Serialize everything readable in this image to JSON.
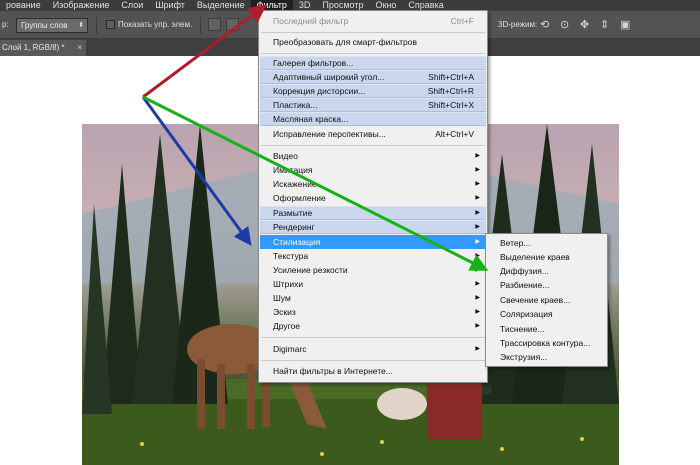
{
  "menubar": {
    "items": [
      "рование",
      "Изображение",
      "Слои",
      "Шрифт",
      "Выделение",
      "Фильтр",
      "3D",
      "Просмотр",
      "Окно",
      "Справка"
    ],
    "active_index": 5
  },
  "options": {
    "prefix": "р:",
    "select_value": "Группы слов",
    "checkbox_label": "Показать упр. элем.",
    "mode_label": "3D-режим:"
  },
  "tab": {
    "label": "Слой 1, RGB/8) *",
    "close": "×"
  },
  "filter_menu": {
    "last_filter": {
      "label": "Последний фильтр",
      "shortcut": "Ctrl+F"
    },
    "convert": "Преобразовать для смарт-фильтров",
    "gallery": "Галерея фильтров...",
    "adaptive": {
      "label": "Адаптивный широкий угол...",
      "shortcut": "Shift+Ctrl+A"
    },
    "lens": {
      "label": "Коррекция дисторсии...",
      "shortcut": "Shift+Ctrl+R"
    },
    "liquify": {
      "label": "Пластика...",
      "shortcut": "Shift+Ctrl+X"
    },
    "oil": "Масляная краска...",
    "vanishing": {
      "label": "Исправление перспективы...",
      "shortcut": "Alt+Ctrl+V"
    },
    "groups": [
      "Видео",
      "Имитация",
      "Искажение",
      "Оформление",
      "Размытие",
      "Рендеринг",
      "Стилизация",
      "Текстура",
      "Усиление резкости",
      "Штрихи",
      "Шум",
      "Эскиз",
      "Другое"
    ],
    "digimarc": "Digimarc",
    "online": "Найти фильтры в Интернете..."
  },
  "stylize_submenu": {
    "items": [
      "Ветер...",
      "Выделение краев",
      "Диффузия...",
      "Разбиение...",
      "Свечение краев...",
      "Соляризация",
      "Тиснение...",
      "Трассировка контура...",
      "Экструзия..."
    ]
  },
  "colors": {
    "menu_highlight": "#c9d6ec",
    "menu_selected": "#3399ff",
    "arrow_red": "#b01c2e",
    "arrow_blue": "#1f3aa8",
    "arrow_green": "#16b316"
  }
}
